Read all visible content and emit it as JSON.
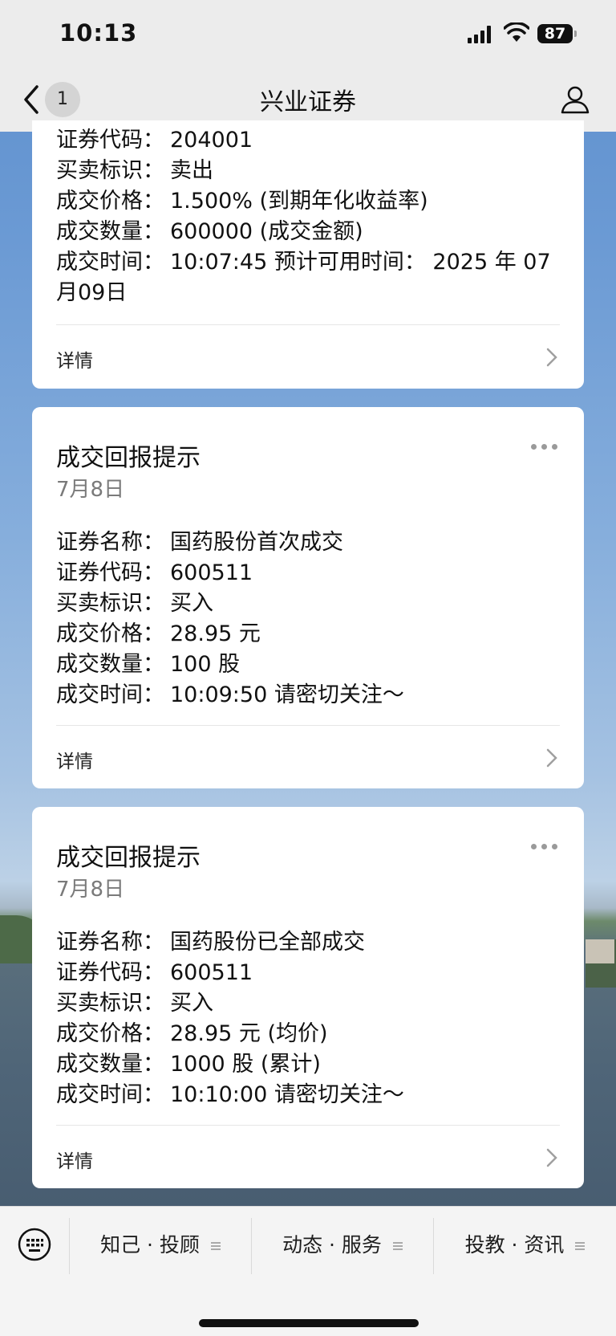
{
  "status": {
    "time": "10:13",
    "battery": "87"
  },
  "nav": {
    "badge": "1",
    "title": "兴业证券"
  },
  "cards": [
    {
      "fields": [
        {
          "label": "证券代码：",
          "value": "204001"
        },
        {
          "label": "买卖标识：",
          "value": "卖出"
        },
        {
          "label": "成交价格：",
          "value": "1.500% (到期年化收益率)"
        },
        {
          "label": "成交数量：",
          "value": "600000 (成交金额)"
        },
        {
          "label": "成交时间：",
          "value": "10:07:45 预计可用时间： 2025 年 07 月09日"
        }
      ],
      "detail": "详情"
    },
    {
      "title": "成交回报提示",
      "date": "7月8日",
      "fields": [
        {
          "label": "证券名称：",
          "value": "国药股份首次成交"
        },
        {
          "label": "证券代码：",
          "value": "600511"
        },
        {
          "label": "买卖标识：",
          "value": "买入"
        },
        {
          "label": "成交价格：",
          "value": "28.95 元"
        },
        {
          "label": "成交数量：",
          "value": "100 股"
        },
        {
          "label": "成交时间：",
          "value": "10:09:50 请密切关注～"
        }
      ],
      "detail": "详情"
    },
    {
      "title": "成交回报提示",
      "date": "7月8日",
      "fields": [
        {
          "label": "证券名称：",
          "value": "国药股份已全部成交"
        },
        {
          "label": "证券代码：",
          "value": "600511"
        },
        {
          "label": "买卖标识：",
          "value": "买入"
        },
        {
          "label": "成交价格：",
          "value": "28.95 元 (均价)"
        },
        {
          "label": "成交数量：",
          "value": "1000 股 (累计)"
        },
        {
          "label": "成交时间：",
          "value": "10:10:00 请密切关注～"
        }
      ],
      "detail": "详情"
    }
  ],
  "bottom_menu": [
    {
      "label": "知己 · 投顾"
    },
    {
      "label": "动态 · 服务"
    },
    {
      "label": "投教 · 资讯"
    }
  ],
  "icons": [
    "keyboard-icon",
    "back-chevron-icon",
    "profile-icon",
    "more-icon",
    "chevron-right-icon"
  ]
}
